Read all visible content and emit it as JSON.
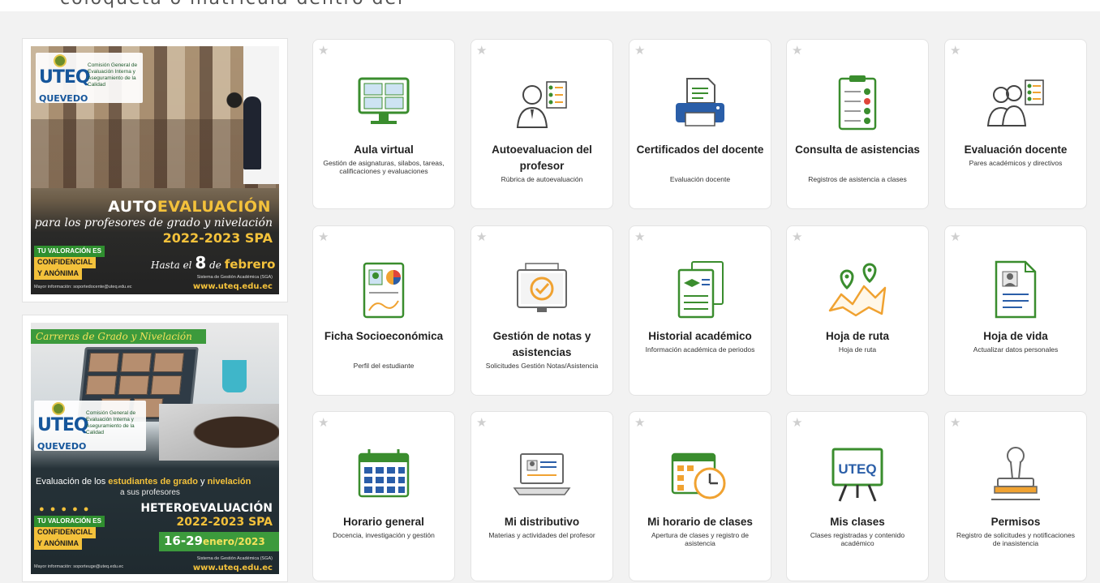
{
  "banner": {
    "text": "coloqueta  o  matricula  dentro  del"
  },
  "promo1": {
    "logo": "UTEQ",
    "logo_city": "QUEVEDO",
    "org": "Comisión General de Evaluación Interna y Aseguramiento de la Calidad",
    "headline_a": "AUTO",
    "headline_b": "EVALUACIÓN",
    "script": "para los profesores de grado y nivelación",
    "period": "2022-2023 SPA",
    "tag1": "TU VALORACIÓN ES",
    "tag2": "CONFIDENCIAL",
    "tag3": "Y ANÓNIMA",
    "deadline_pre": "Hasta el",
    "deadline_day": "8",
    "deadline_de": "de",
    "deadline_month": "febrero",
    "info": "Mayor información: soportedocente@uteq.edu.ec",
    "system": "Sistema de Gestión Académica (SGA)",
    "web": "www.uteq.edu.ec"
  },
  "promo2": {
    "ribbon": "Carreras de Grado y Nivelación",
    "logo": "UTEQ",
    "logo_city": "QUEVEDO",
    "org": "Comisión General de Evaluación Interna y Aseguramiento de la Calidad",
    "eval_pre": "Evaluación de los",
    "eval_hl1": "estudiantes de grado",
    "eval_mid": "y",
    "eval_hl2": "nivelación",
    "eval_line2": "a sus profesores",
    "dots": "● ● ● ● ●",
    "tag1": "TU VALORACIÓN ES",
    "tag2": "CONFIDENCIAL",
    "tag3": "Y ANÓNIMA",
    "hetero": "HETEROEVALUACIÓN",
    "period": "2022-2023 SPA",
    "dates": "16-29",
    "dates_month": "enero/2023",
    "info": "Mayor información: soporteuge@uteq.edu.ec",
    "system": "Sistema de Gestión Académica (SGA)",
    "web": "www.uteq.edu.ec"
  },
  "tiles": [
    {
      "title": "Aula virtual",
      "desc": "Gestión de asignaturas, silabos, tareas, calificaciones y evaluaciones",
      "icon": "monitor-icon"
    },
    {
      "title": "Autoevaluacion del profesor",
      "desc": "Rúbrica de autoevaluación",
      "icon": "person-checklist-icon"
    },
    {
      "title": "Certificados del docente",
      "desc": "Evaluación docente",
      "icon": "printer-icon"
    },
    {
      "title": "Consulta de asistencias",
      "desc": "Registros de asistencia a clases",
      "icon": "clipboard-check-icon"
    },
    {
      "title": "Evaluación docente",
      "desc": "Pares académicos y directivos",
      "icon": "people-checklist-icon"
    },
    {
      "title": "Ficha Socioeconómica",
      "desc": "Perfil del estudiante",
      "icon": "profile-card-icon"
    },
    {
      "title": "Gestión de notas y asistencias",
      "desc": "Solicitudes Gestión Notas/Asistencia",
      "icon": "monitor-check-icon"
    },
    {
      "title": "Historial académico",
      "desc": "Información académica de periodos",
      "icon": "documents-icon"
    },
    {
      "title": "Hoja de ruta",
      "desc": "Hoja de ruta",
      "icon": "map-route-icon"
    },
    {
      "title": "Hoja de vida",
      "desc": "Actualizar datos personales",
      "icon": "cv-document-icon"
    },
    {
      "title": "Horario general",
      "desc": "Docencia, investigación y gestión",
      "icon": "calendar-icon"
    },
    {
      "title": "Mi distributivo",
      "desc": "Materias y actividades del profesor",
      "icon": "laptop-id-icon"
    },
    {
      "title": "Mi horario de clases",
      "desc": "Apertura de clases y registro de asistencia",
      "icon": "calendar-clock-icon"
    },
    {
      "title": "Mis clases",
      "desc": "Clases registradas y contenido académico",
      "icon": "easel-board-icon",
      "board_text": "UTEQ"
    },
    {
      "title": "Permisos",
      "desc": "Registro de solicitudes y notificaciones de inasistencia",
      "icon": "stamp-icon"
    }
  ],
  "colors": {
    "green": "#3a8d2e",
    "accent": "#f0a231",
    "red": "#e0453a",
    "blue": "#2a5ea8",
    "star": "#cfcfcf"
  }
}
